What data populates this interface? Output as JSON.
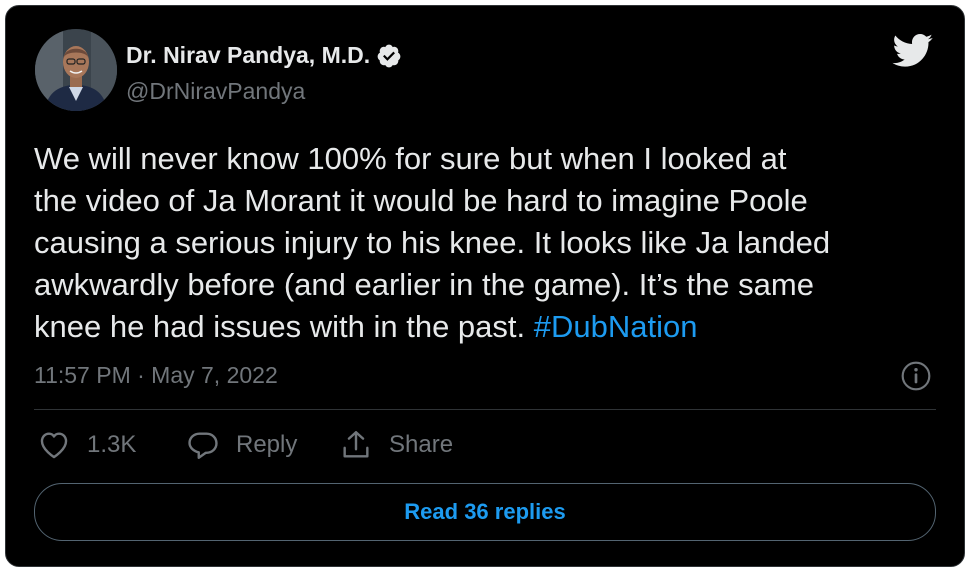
{
  "author": {
    "display_name": "Dr. Nirav Pandya, M.D.",
    "handle": "@DrNiravPandya",
    "verified": true
  },
  "tweet": {
    "text_lines": [
      "We will never know 100% for sure but when I looked at",
      "the video of Ja Morant it would be hard to imagine Poole",
      "causing a serious injury to his knee. It looks like Ja landed",
      "awkwardly before (and earlier in the game). It’s the same",
      "knee he had issues with in the past. "
    ],
    "hashtag": "#DubNation",
    "timestamp": "11:57 PM · May 7, 2022"
  },
  "actions": {
    "like_count": "1.3K",
    "reply_label": "Reply",
    "share_label": "Share"
  },
  "read_replies_label": "Read 36 replies",
  "colors": {
    "background": "#000000",
    "text_primary": "#e7e9ea",
    "text_secondary": "#71767b",
    "accent": "#1d9bf0",
    "border": "#2f3336"
  },
  "icons": [
    "verified-badge-icon",
    "twitter-bird-icon",
    "info-icon",
    "heart-icon",
    "reply-bubble-icon",
    "share-icon"
  ]
}
